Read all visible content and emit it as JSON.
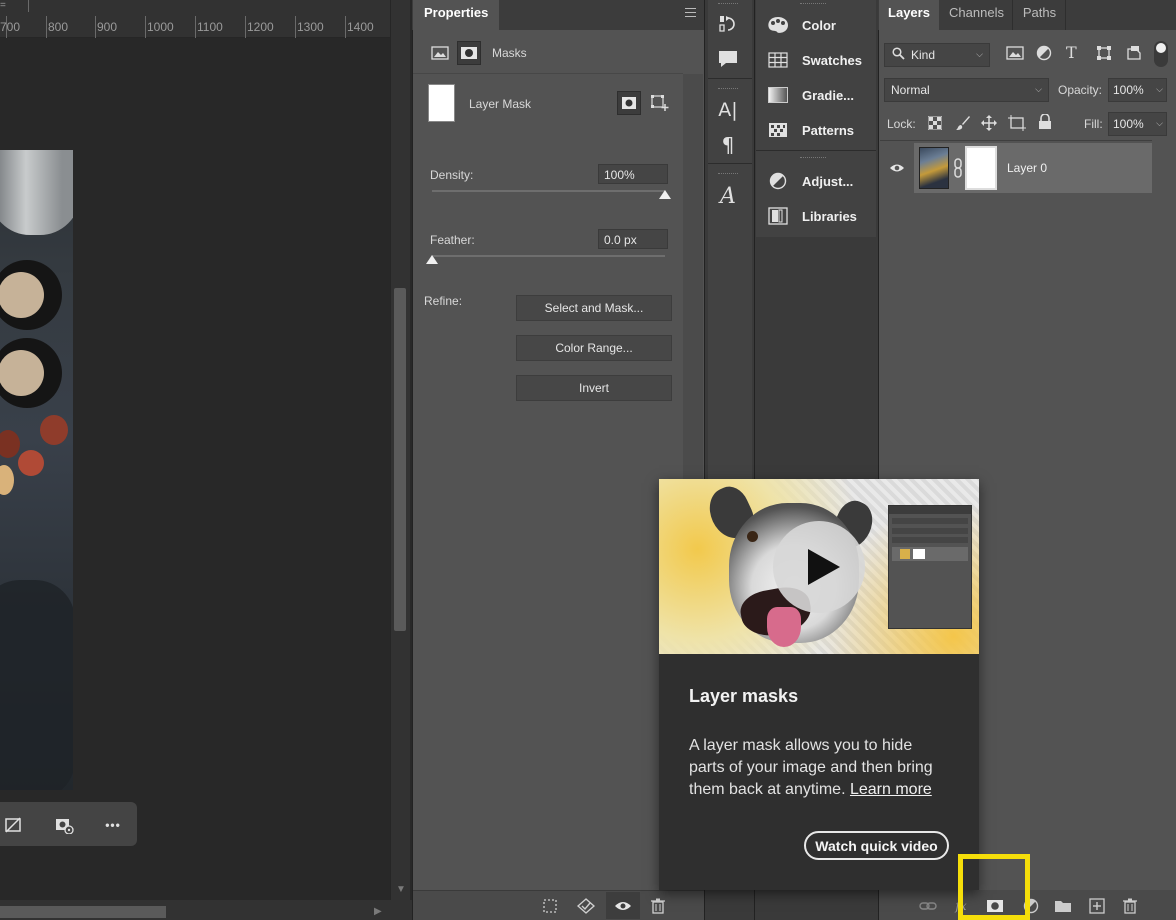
{
  "ruler": {
    "ticks": [
      "700",
      "800",
      "900",
      "1000",
      "1100",
      "1200",
      "1300",
      "1400"
    ]
  },
  "canvas_context_bar": {
    "icons": [
      "hide-mask-icon",
      "mask-visibility-icon",
      "more-icon"
    ],
    "more_label": "•••"
  },
  "properties": {
    "tab_label": "Properties",
    "mask_mode_label": "Masks",
    "mask_name": "Layer Mask",
    "density_label": "Density:",
    "density_value": "100%",
    "density_level": 1.0,
    "feather_label": "Feather:",
    "feather_value": "0.0 px",
    "feather_level": 0.0,
    "refine_label": "Refine:",
    "buttons": {
      "select_and_mask": "Select and Mask...",
      "color_range": "Color Range...",
      "invert": "Invert"
    },
    "footer_icons": [
      "load-selection-icon",
      "apply-mask-icon",
      "visibility-eye-icon",
      "delete-mask-icon"
    ]
  },
  "strip_icons": [
    "history-icon",
    "comment-icon",
    "character-icon",
    "paragraph-icon",
    "glyphs-icon"
  ],
  "strip_text": {
    "character": "A|",
    "paragraph": "¶",
    "glyphs": "A"
  },
  "mid_panels": [
    {
      "label": "Color",
      "icon": "palette-icon"
    },
    {
      "label": "Swatches",
      "icon": "swatches-icon"
    },
    {
      "label": "Gradie...",
      "icon": "gradient-icon"
    },
    {
      "label": "Patterns",
      "icon": "patterns-icon"
    },
    {
      "label": "Adjust...",
      "icon": "adjustments-icon"
    },
    {
      "label": "Libraries",
      "icon": "libraries-icon"
    }
  ],
  "layers": {
    "tabs": [
      "Layers",
      "Channels",
      "Paths"
    ],
    "active_tab": "Layers",
    "filter_kind": "Kind",
    "blend_mode": "Normal",
    "opacity_label": "Opacity:",
    "opacity_value": "100%",
    "lock_label": "Lock:",
    "fill_label": "Fill:",
    "fill_value": "100%",
    "layer_name": "Layer 0",
    "footer_icons": [
      "link-icon",
      "fx-icon",
      "add-mask-icon",
      "adjustment-layer-icon",
      "folder-icon",
      "new-layer-icon",
      "trash-icon"
    ],
    "fx_label": "fx"
  },
  "tooltip": {
    "title": "Layer masks",
    "description": "A layer mask allows you to hide parts of your image and then bring them back at anytime.",
    "learn_more": "Learn more",
    "watch_button": "Watch quick video"
  },
  "colors": {
    "highlight": "#f5de0a",
    "panel": "#535353",
    "canvas": "#282828",
    "card": "#2f2f2f"
  }
}
